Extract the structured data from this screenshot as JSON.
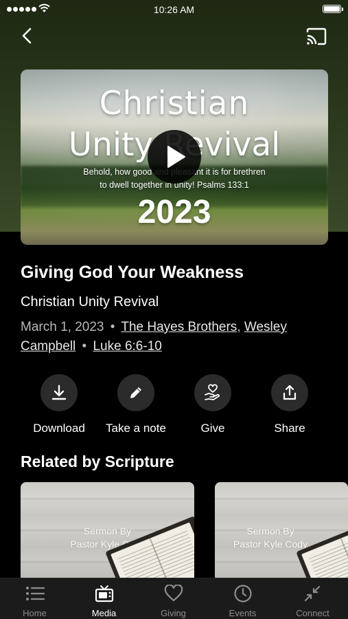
{
  "status_bar": {
    "time": "10:26 AM"
  },
  "video": {
    "title_line1": "Christian",
    "title_line2": "Unity Revival",
    "verse_line1": "Behold, how good and pleasant it is for brethren",
    "verse_line2": "to dwell together in unity!  Psalms 133:1",
    "year": "2023"
  },
  "sermon": {
    "title": "Giving God Your Weakness",
    "series": "Christian Unity Revival",
    "date": "March 1, 2023",
    "speaker1": "The Hayes Brothers",
    "speaker_separator": ",",
    "speaker2_line1": "Wesley",
    "speaker2_line2": "Campbell",
    "separator": "•",
    "scripture": "Luke 6:6-10"
  },
  "actions": [
    {
      "label": "Download",
      "icon": "download-icon"
    },
    {
      "label": "Take a note",
      "icon": "pencil-icon"
    },
    {
      "label": "Give",
      "icon": "heart-hand-icon"
    },
    {
      "label": "Share",
      "icon": "share-icon"
    }
  ],
  "related": {
    "title": "Related by Scripture",
    "cards": [
      {
        "line1": "Sermon By",
        "line2": "Pastor Kyle Cody"
      },
      {
        "line1": "Sermon By",
        "line2": "Pastor Kyle Cody"
      }
    ]
  },
  "tabs": [
    {
      "label": "Home",
      "icon": "list-icon",
      "active": false
    },
    {
      "label": "Media",
      "icon": "tv-icon",
      "active": true
    },
    {
      "label": "Giving",
      "icon": "heart-icon",
      "active": false
    },
    {
      "label": "Events",
      "icon": "clock-icon",
      "active": false
    },
    {
      "label": "Connect",
      "icon": "connect-icon",
      "active": false
    }
  ],
  "colors": {
    "background": "#000000",
    "hero_tint": "#2c3a1e",
    "action_circle": "#2b2b2b",
    "tab_inactive": "#8e8e8e",
    "tab_active": "#ffffff"
  }
}
